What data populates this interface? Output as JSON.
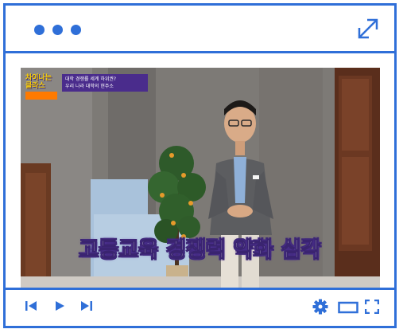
{
  "window": {
    "accent_color": "#2f6fd8",
    "title_dots": [
      "dot",
      "dot",
      "dot"
    ],
    "expand_icon": "expand-arrow-icon"
  },
  "video": {
    "caption": "고등교육 경쟁력 약화 심각",
    "badge_title": "차이나는 클라스",
    "badge_subtitle": "",
    "topic_lines": [
      "대학 경쟁률 세계 하위권?",
      "우리 나라 대학의 현주소"
    ]
  },
  "controls": {
    "left": [
      "skip-back-icon",
      "play-icon",
      "skip-forward-icon"
    ],
    "right": [
      "gear-icon",
      "theater-mode-icon",
      "fullscreen-icon"
    ]
  }
}
